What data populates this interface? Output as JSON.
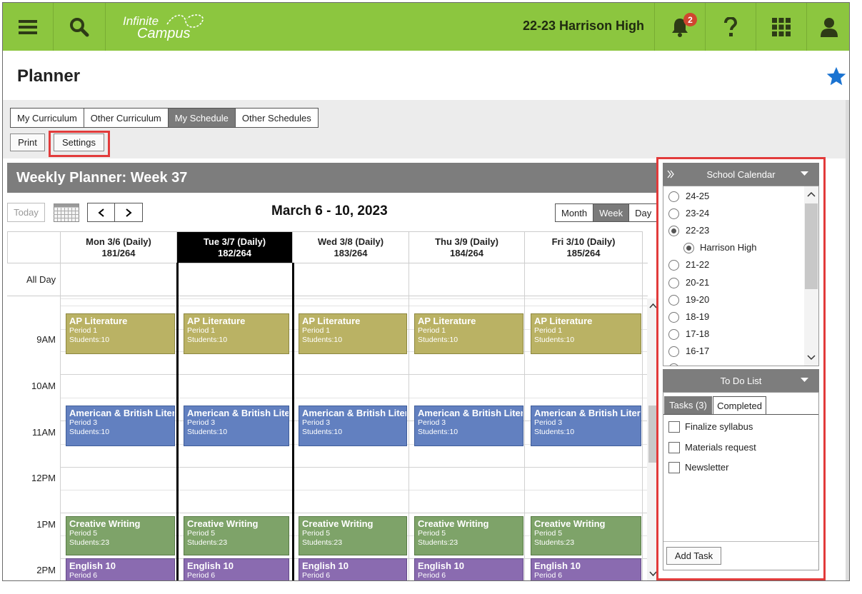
{
  "topbar": {
    "menu_icon": "hamburger-icon",
    "search_icon": "search-icon",
    "logo_line1": "Infinite",
    "logo_line2": "Campus",
    "school": "22-23 Harrison High",
    "notification_count": "2",
    "help_icon": "question-icon",
    "apps_icon": "grid-icon",
    "user_icon": "person-icon"
  },
  "page": {
    "title": "Planner"
  },
  "tabs": [
    "My Curriculum",
    "Other Curriculum",
    "My Schedule",
    "Other Schedules"
  ],
  "active_tab": "My Schedule",
  "toolbar": {
    "print": "Print",
    "settings": "Settings"
  },
  "planner": {
    "heading": "Weekly Planner: Week 37",
    "today": "Today",
    "date_range": "March 6 - 10, 2023",
    "views": [
      "Month",
      "Week",
      "Day"
    ],
    "active_view": "Week",
    "all_day_label": "All Day",
    "days": [
      {
        "label": "Mon 3/6 (Daily)",
        "count": "181/264"
      },
      {
        "label": "Tue 3/7 (Daily)",
        "count": "182/264"
      },
      {
        "label": "Wed 3/8 (Daily)",
        "count": "183/264"
      },
      {
        "label": "Thu 3/9 (Daily)",
        "count": "184/264"
      },
      {
        "label": "Fri 3/10 (Daily)",
        "count": "185/264"
      }
    ],
    "times": [
      "9AM",
      "10AM",
      "11AM",
      "12PM",
      "1PM",
      "2PM"
    ],
    "events": [
      {
        "name": "AP Literature",
        "period": "Period 1",
        "students": "Students:10",
        "color": "#bab264"
      },
      {
        "name": "American & British Literature",
        "period": "Period 3",
        "students": "Students:10",
        "color": "#6280c0"
      },
      {
        "name": "Creative Writing",
        "period": "Period 5",
        "students": "Students:23",
        "color": "#7ea369"
      },
      {
        "name": "English 10",
        "period": "Period 6",
        "students": "",
        "color": "#8a6bb0"
      }
    ]
  },
  "school_calendar": {
    "title": "School Calendar",
    "years": [
      "24-25",
      "23-24",
      "22-23",
      "21-22",
      "20-21",
      "19-20",
      "18-19",
      "17-18",
      "16-17"
    ],
    "selected_year": "22-23",
    "school": "Harrison High"
  },
  "todo": {
    "title": "To Do List",
    "tabs": [
      "Tasks (3)",
      "Completed"
    ],
    "items": [
      "Finalize syllabus",
      "Materials request",
      "Newsletter"
    ],
    "add_task": "Add Task"
  },
  "colors": {
    "topbar": "#8cc63f",
    "highlight": "#e23b3b",
    "star": "#1a73d1",
    "badge": "#d0452f"
  }
}
